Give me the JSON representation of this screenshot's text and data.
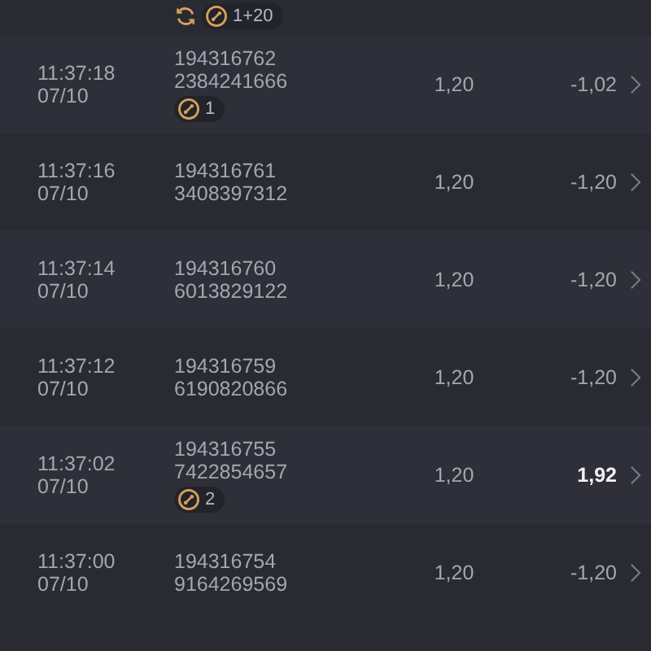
{
  "top_partial_row": {
    "badges": [
      {
        "kind": "refresh"
      },
      {
        "kind": "coin",
        "count": "1+20"
      }
    ]
  },
  "rows": [
    {
      "time": "11:37:18",
      "date": "07/10",
      "round_id": "194316762",
      "ticket_id": "2384241666",
      "stake": "1,20",
      "result": "-1,02",
      "win": false,
      "badges": [
        {
          "kind": "coin",
          "count": "1"
        }
      ]
    },
    {
      "time": "11:37:16",
      "date": "07/10",
      "round_id": "194316761",
      "ticket_id": "3408397312",
      "stake": "1,20",
      "result": "-1,20",
      "win": false,
      "badges": []
    },
    {
      "time": "11:37:14",
      "date": "07/10",
      "round_id": "194316760",
      "ticket_id": "6013829122",
      "stake": "1,20",
      "result": "-1,20",
      "win": false,
      "badges": []
    },
    {
      "time": "11:37:12",
      "date": "07/10",
      "round_id": "194316759",
      "ticket_id": "6190820866",
      "stake": "1,20",
      "result": "-1,20",
      "win": false,
      "badges": []
    },
    {
      "time": "11:37:02",
      "date": "07/10",
      "round_id": "194316755",
      "ticket_id": "7422854657",
      "stake": "1,20",
      "result": "1,92",
      "win": true,
      "badges": [
        {
          "kind": "coin",
          "count": "2"
        }
      ]
    },
    {
      "time": "11:37:00",
      "date": "07/10",
      "round_id": "194316754",
      "ticket_id": "9164269569",
      "stake": "1,20",
      "result": "-1,20",
      "win": false,
      "badges": []
    }
  ]
}
